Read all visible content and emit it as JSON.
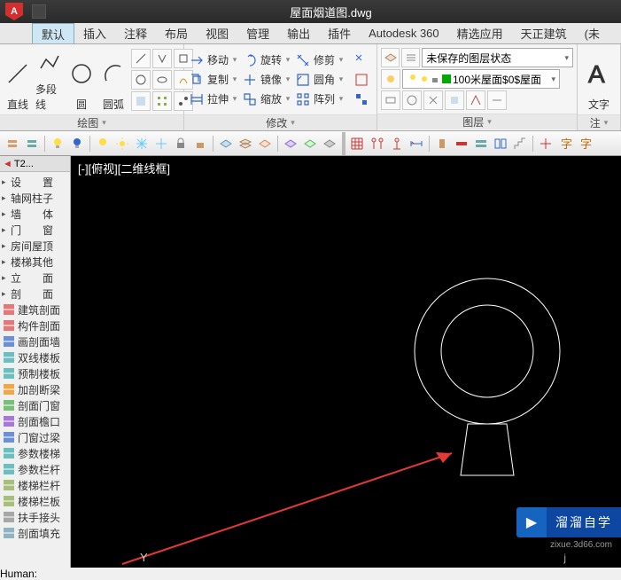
{
  "titlebar": {
    "app": "A",
    "title": "屋面烟道图.dwg"
  },
  "tabs": [
    "默认",
    "插入",
    "注释",
    "布局",
    "视图",
    "管理",
    "输出",
    "插件",
    "Autodesk 360",
    "精选应用",
    "天正建筑",
    "(未"
  ],
  "active_tab": 0,
  "ribbon": {
    "draw": {
      "items": [
        "直线",
        "多段线",
        "圆",
        "圆弧"
      ],
      "title": "绘图"
    },
    "modify": {
      "rows": [
        [
          "移动",
          "旋转",
          "修剪"
        ],
        [
          "复制",
          "镜像",
          "圆角"
        ],
        [
          "拉伸",
          "缩放",
          "阵列"
        ]
      ],
      "title": "修改"
    },
    "layer": {
      "unsaved": "未保存的图层状态",
      "current": "100米屋面$0$屋面",
      "title": "图层"
    },
    "anno": {
      "text": "文字",
      "title": "注"
    }
  },
  "left_panel": {
    "tab": "T2...",
    "groups": [
      {
        "icon": "blank",
        "label": "设　　置"
      },
      {
        "icon": "blank",
        "label": "轴网柱子"
      },
      {
        "icon": "blank",
        "label": "墙　　体"
      },
      {
        "icon": "blank",
        "label": "门　　窗"
      },
      {
        "icon": "blank",
        "label": "房间屋顶"
      },
      {
        "icon": "blank",
        "label": "楼梯其他"
      },
      {
        "icon": "blank",
        "label": "立　　面"
      },
      {
        "icon": "blank",
        "label": "剖　　面"
      }
    ],
    "items": [
      {
        "icon": "red",
        "label": "建筑剖面"
      },
      {
        "icon": "red",
        "label": "构件剖面"
      },
      {
        "icon": "blue",
        "label": "画剖面墙"
      },
      {
        "icon": "cyan",
        "label": "双线楼板"
      },
      {
        "icon": "cyan",
        "label": "预制楼板"
      },
      {
        "icon": "orange",
        "label": "加剖断梁"
      },
      {
        "icon": "green",
        "label": "剖面门窗"
      },
      {
        "icon": "purple",
        "label": "剖面檐口"
      },
      {
        "icon": "blue",
        "label": "门窗过梁"
      },
      {
        "icon": "cyan",
        "label": "参数楼梯"
      },
      {
        "icon": "cyan",
        "label": "参数栏杆"
      },
      {
        "icon": "olive",
        "label": "楼梯栏杆"
      },
      {
        "icon": "olive",
        "label": "楼梯栏板"
      },
      {
        "icon": "gray",
        "label": "扶手接头"
      },
      {
        "icon": "hatch",
        "label": "剖面填充"
      }
    ]
  },
  "viewport": {
    "label": "[-][俯视][二维线框]",
    "coord": "Y"
  },
  "watermark": {
    "text": "溜溜自学",
    "url": "zixue.3d66.com",
    "j": "j"
  }
}
